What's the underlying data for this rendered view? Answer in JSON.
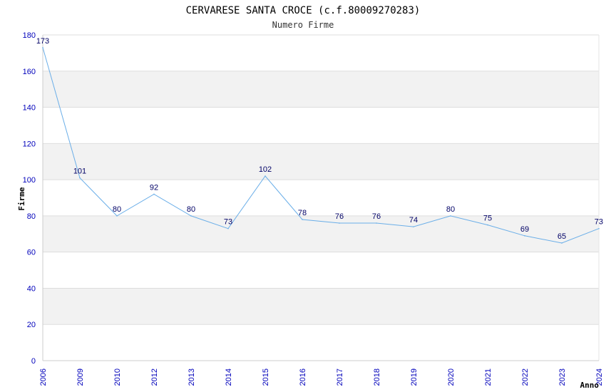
{
  "chart_data": {
    "type": "line",
    "title": "CERVARESE SANTA CROCE (c.f.80009270283)",
    "subtitle": "Numero Firme",
    "xlabel": "Anno",
    "ylabel": "Firme",
    "categories": [
      "2006",
      "2009",
      "2010",
      "2012",
      "2013",
      "2014",
      "2015",
      "2016",
      "2017",
      "2018",
      "2019",
      "2020",
      "2021",
      "2022",
      "2023",
      "2024"
    ],
    "series": [
      {
        "values": [
          173,
          101,
          80,
          92,
          80,
          73,
          102,
          78,
          76,
          76,
          74,
          80,
          75,
          69,
          65,
          73
        ]
      }
    ],
    "ylim": [
      0,
      180
    ],
    "yticks": [
      0,
      20,
      40,
      60,
      80,
      100,
      120,
      140,
      160,
      180
    ],
    "grid": true,
    "colors": {
      "line": "#6aaee8",
      "band": "#f2f2f2",
      "grid": "#dddddd",
      "tick": "#0000bb",
      "label": "#000066"
    }
  }
}
